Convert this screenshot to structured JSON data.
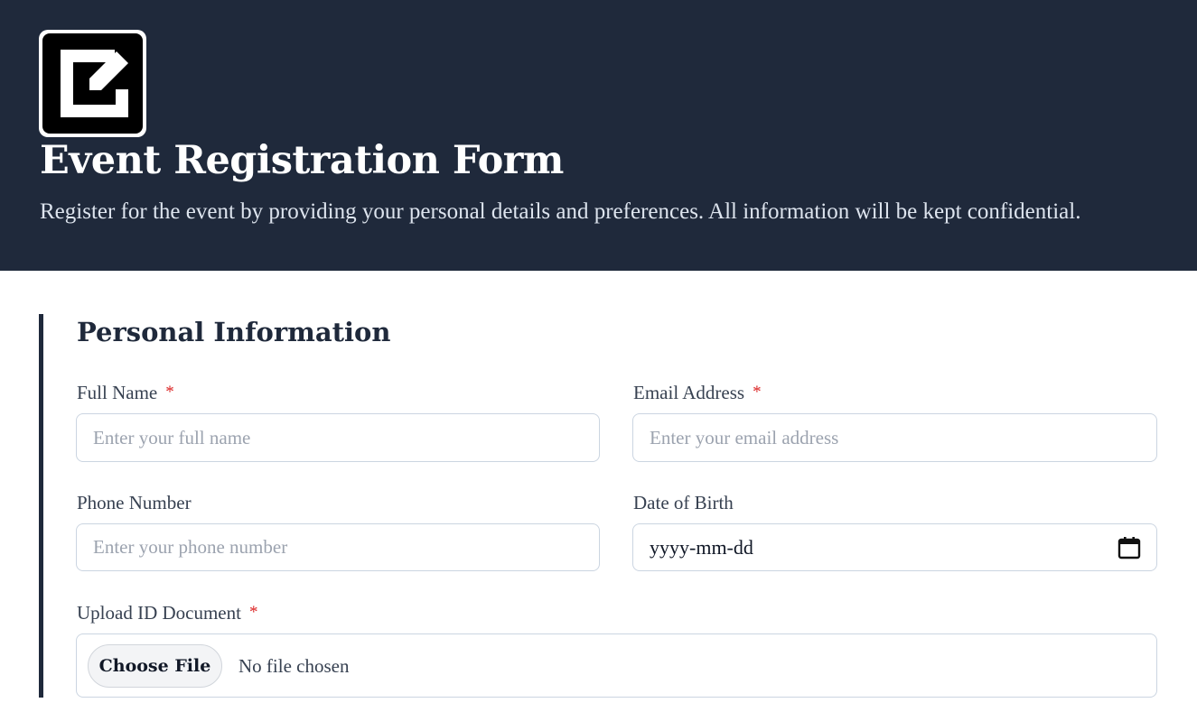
{
  "header": {
    "logo_icon": "edit-square-icon",
    "title": "Event Registration Form",
    "subtitle": "Register for the event by providing your personal details and preferences. All information will be kept confidential."
  },
  "section": {
    "title": "Personal Information",
    "required_marker": "*",
    "fields": {
      "full_name": {
        "label": "Full Name",
        "placeholder": "Enter your full name",
        "required": true
      },
      "email": {
        "label": "Email Address",
        "placeholder": "Enter your email address",
        "required": true
      },
      "phone": {
        "label": "Phone Number",
        "placeholder": "Enter your phone number",
        "required": false
      },
      "dob": {
        "label": "Date of Birth",
        "value": "yyyy-mm-dd",
        "icon": "calendar-icon"
      },
      "id_document": {
        "label": "Upload ID Document",
        "button_label": "Choose File",
        "status": "No file chosen",
        "required": true
      }
    }
  },
  "colors": {
    "header_bg": "#1f293b",
    "accent_border": "#1f293b",
    "required": "#dc2626"
  }
}
